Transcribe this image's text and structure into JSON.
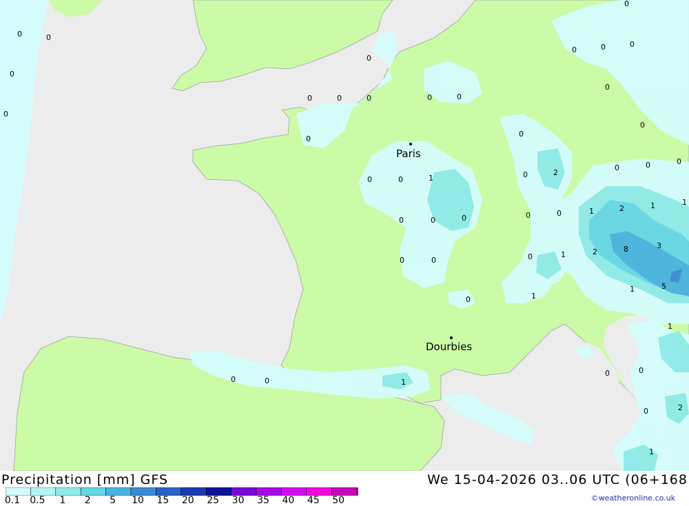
{
  "title": {
    "left": "Precipitation [mm] GFS",
    "right": "We 15-04-2026 03..06 UTC (06+168"
  },
  "credit": "©weatheronline.co.uk",
  "colors": {
    "sea": "#ececec",
    "land": "#ccfba8",
    "ocean_strip": "#d4fcfc",
    "precip": [
      "#d4fcfc",
      "#b4f4f4",
      "#8eeaea",
      "#66d6e6",
      "#4ab2e0",
      "#3a8ad6",
      "#2a62c8",
      "#1a3ab0",
      "#0e1496",
      "#7a0ad6",
      "#a20ae6",
      "#d20aee",
      "#ee0ada",
      "#c40ab4",
      "#a00a96"
    ]
  },
  "legend": {
    "ticks": [
      "0.1",
      "0.5",
      "1",
      "2",
      "5",
      "10",
      "15",
      "20",
      "25",
      "30",
      "35",
      "40",
      "45",
      "50"
    ]
  },
  "cities": [
    {
      "name": "Paris"
    },
    {
      "name": "Dourbies"
    }
  ],
  "grid_values": [
    "0",
    "0",
    "0",
    "0",
    "0",
    "0",
    "0",
    "0",
    "0",
    "0",
    "0",
    "0",
    "0",
    "0",
    "0",
    "0",
    "0",
    "2",
    "0",
    "0",
    "1",
    "0",
    "0",
    "1",
    "0",
    "0",
    "0",
    "0",
    "0",
    "0",
    "0",
    "0",
    "1",
    "2",
    "1",
    "1",
    "3",
    "2",
    "8",
    "1",
    "5",
    "1",
    "1",
    "0",
    "0",
    "0",
    "0",
    "0",
    "0",
    "1",
    "0",
    "0",
    "2",
    "1",
    "0"
  ]
}
